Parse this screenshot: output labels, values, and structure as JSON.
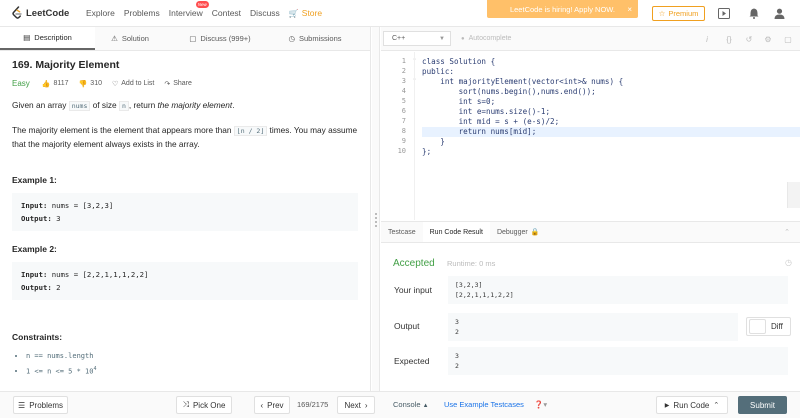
{
  "nav": {
    "logo_text": "LeetCode",
    "items": [
      "Explore",
      "Problems",
      "Interview",
      "Contest",
      "Discuss",
      "Store"
    ],
    "new_badge": "New",
    "hiring": "LeetCode is hiring! Apply NOW.",
    "hiring_close": "×",
    "premium": "Premium"
  },
  "left_tabs": [
    {
      "label": "Description",
      "icon": "file-icon"
    },
    {
      "label": "Solution",
      "icon": "flask-icon"
    },
    {
      "label": "Discuss (999+)",
      "icon": "chat-icon"
    },
    {
      "label": "Submissions",
      "icon": "history-icon"
    }
  ],
  "problem": {
    "title": "169. Majority Element",
    "difficulty": "Easy",
    "likes": "8117",
    "dislikes": "310",
    "add_to_list": "Add to List",
    "share": "Share",
    "p1_a": "Given an array ",
    "p1_code1": "nums",
    "p1_b": " of size ",
    "p1_code2": "n",
    "p1_c": ", return ",
    "p1_em": "the majority element",
    "p1_d": ".",
    "p2_a": "The majority element is the element that appears more than ",
    "p2_code": "⌊n / 2⌋",
    "p2_b": " times. You may assume that the majority element always exists in the array.",
    "ex1_title": "Example 1:",
    "ex1_input_label": "Input:",
    "ex1_input": " nums = [3,2,3]",
    "ex1_output_label": "Output:",
    "ex1_output": " 3",
    "ex2_title": "Example 2:",
    "ex2_input_label": "Input:",
    "ex2_input": " nums = [2,2,1,1,1,2,2]",
    "ex2_output_label": "Output:",
    "ex2_output": " 2",
    "constraints_title": "Constraints:",
    "constraint1": "n == nums.length",
    "constraint2_a": "1 <= n <= 5 * 10",
    "constraint2_sup": "4"
  },
  "editor": {
    "language": "C++",
    "autocomplete": "Autocomplete",
    "line_numbers": [
      "1",
      "2",
      "3",
      "4",
      "5",
      "6",
      "7",
      "8",
      "9",
      "10"
    ],
    "lines": [
      "class Solution {",
      "public:",
      "    int majorityElement(vector<int>& nums) {",
      "        sort(nums.begin(),nums.end());",
      "        int s=0;",
      "        int e=nums.size()-1;",
      "        int mid = s + (e-s)/2;",
      "        return nums[mid];",
      "    }",
      "};"
    ]
  },
  "console": {
    "tabs": [
      "Testcase",
      "Run Code Result",
      "Debugger"
    ],
    "status": "Accepted",
    "runtime": "Runtime: 0 ms",
    "your_input_label": "Your input",
    "your_input": [
      "[3,2,3]",
      "[2,2,1,1,1,2,2]"
    ],
    "output_label": "Output",
    "output": [
      "3",
      "2"
    ],
    "expected_label": "Expected",
    "expected": [
      "3",
      "2"
    ],
    "diff": "Diff"
  },
  "bottom": {
    "problems": "Problems",
    "pick_one": "Pick One",
    "prev": "Prev",
    "page": "169/2175",
    "next": "Next",
    "console": "Console",
    "use_example": "Use Example Testcases",
    "run_code": "Run Code",
    "submit": "Submit"
  }
}
